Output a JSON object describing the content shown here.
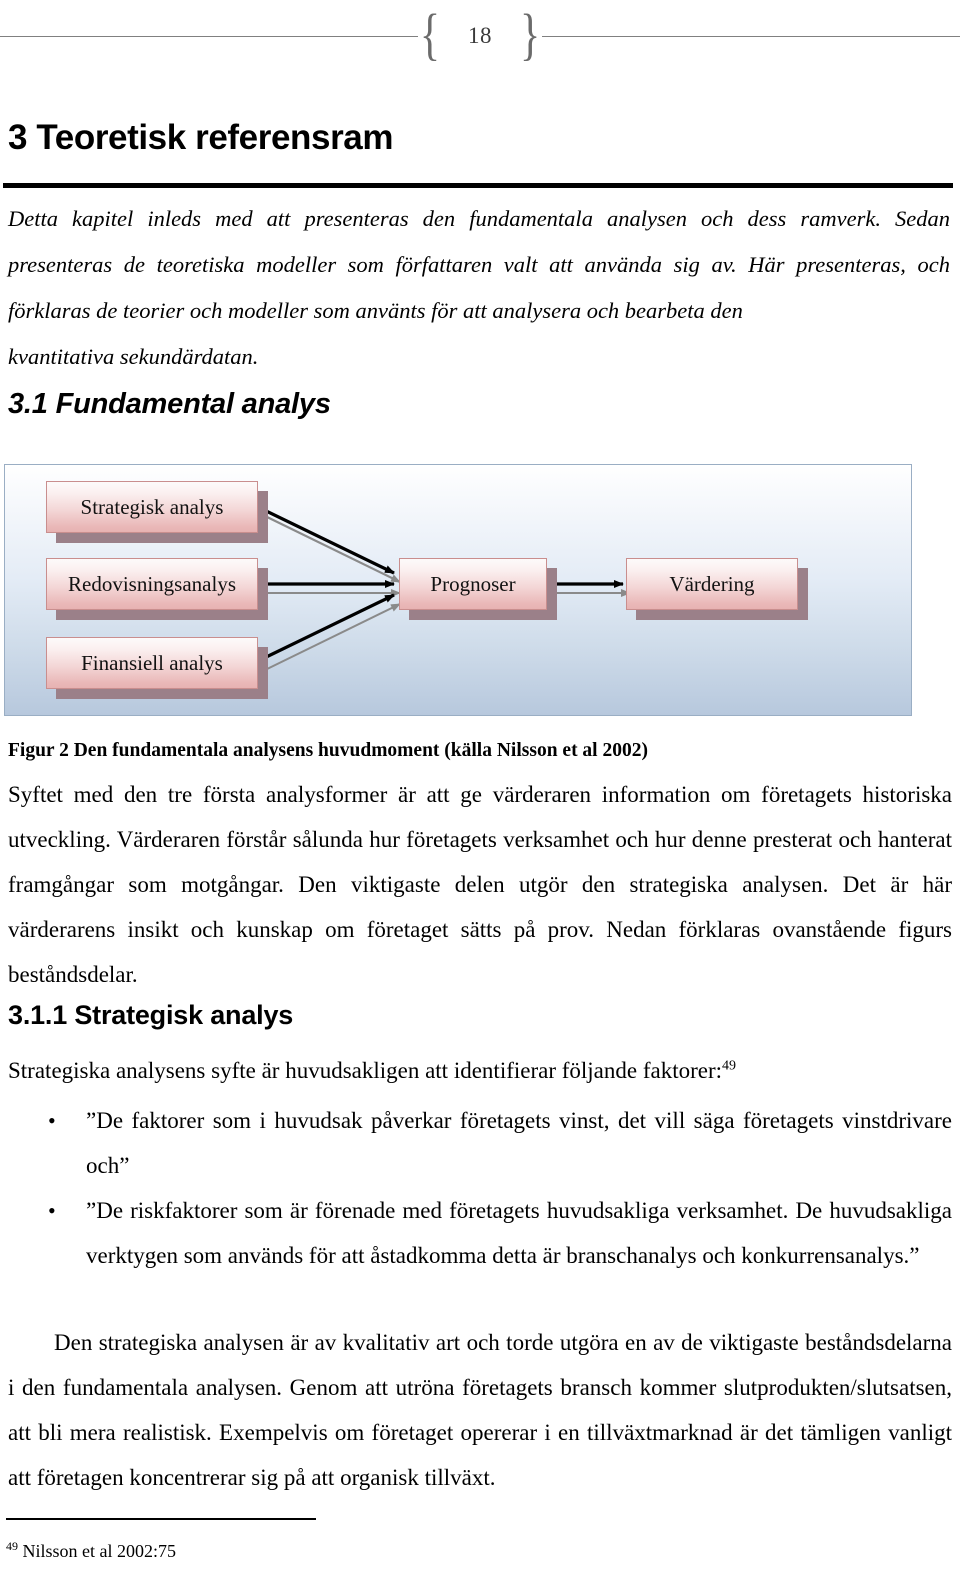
{
  "header": {
    "page_number": "18",
    "brace_left": "{",
    "brace_right": "}"
  },
  "headings": {
    "chapter": "3 Teoretisk referensram",
    "section": "3.1 Fundamental analys",
    "subsection": "3.1.1 Strategisk analys"
  },
  "intro": {
    "line1": "Detta kapitel inleds med att presenteras den fundamentala analysen och dess ramverk. Sedan presenteras de teoretiska modeller som författaren valt att använda sig av. Här presenteras, och förklaras de teorier och modeller som använts för att analysera och bearbeta den",
    "line2": "kvantitativa sekundärdatan."
  },
  "figure": {
    "caption": "Figur 2 Den fundamentala analysens huvudmoment (källa Nilsson et al 2002)",
    "nodes": {
      "strategisk": "Strategisk analys",
      "redovisning": "Redovisningsanalys",
      "finansiell": "Finansiell analys",
      "prognoser": "Prognoser",
      "vardering": "Värdering"
    },
    "colors": {
      "node_border": "#c98e8e",
      "node_fill_top": "#fdfafa",
      "node_fill_bottom": "#e7b2b2",
      "node_shadow": "#9b8089",
      "panel_border": "#9aaec4",
      "panel_bg_top": "#ffffff",
      "panel_bg_bottom": "#b7c8dd",
      "arrow": "#000000",
      "arrow_shadow": "#808080"
    }
  },
  "body": {
    "paragraph_1": "Syftet med den tre första analysformer är att ge värderaren information om företagets historiska utveckling. Värderaren förstår sålunda hur företagets verksamhet och hur denne presterat och hanterat framgångar som motgångar. Den viktigaste delen utgör den strategiska analysen. Det är här värderarens insikt och kunskap om företaget sätts på prov. Nedan förklaras ovanstående figurs beståndsdelar.",
    "paragraph_2_text": "Strategiska analysens syfte är huvudsakligen att identifierar följande faktorer:",
    "paragraph_2_footnote_marker": "49",
    "paragraph_3": "Den strategiska analysen är av kvalitativ art och torde utgöra en av de viktigaste beståndsdelarna i den fundamentala analysen. Genom att utröna företagets bransch kommer slutprodukten/slutsatsen, att bli mera realistisk. Exempelvis om företaget opererar i en tillväxtmarknad är det tämligen vanligt att företagen koncentrerar sig på att organisk tillväxt."
  },
  "bullets": [
    "”De faktorer som i huvudsak påverkar företagets vinst, det vill säga företagets vinstdrivare och”",
    "”De riskfaktorer som är förenade med företagets huvudsakliga verksamhet. De huvudsakliga verktygen som används för att åstadkomma detta är branschanalys och konkurrensanalys.”"
  ],
  "footnote": {
    "marker": "49",
    "text": " Nilsson et al 2002:75"
  }
}
